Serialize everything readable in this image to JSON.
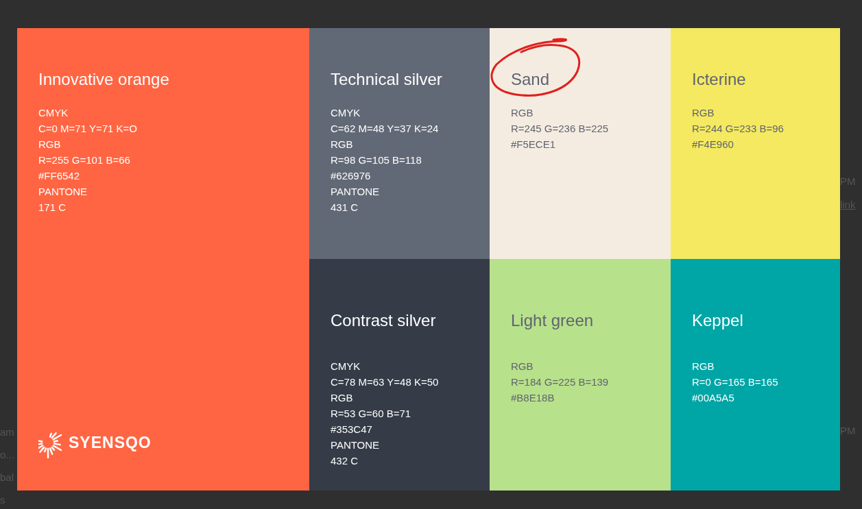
{
  "backdrop": {
    "left_fragments": [
      "am",
      "o...",
      "bal",
      "s"
    ],
    "right_fragments": [
      "PM",
      "link",
      "PM"
    ]
  },
  "slide": {
    "swatches": [
      {
        "name": "Innovative orange",
        "color": "#ff6542",
        "highlighted": false,
        "lines": [
          "CMYK",
          "C=0 M=71 Y=71 K=O",
          "RGB",
          "R=255 G=101 B=66",
          "#FF6542",
          "PANTONE",
          "171 C"
        ]
      },
      {
        "name": "Technical silver",
        "color": "#626976",
        "highlighted": false,
        "lines": [
          "CMYK",
          "C=62 M=48 Y=37 K=24",
          "RGB",
          "R=98 G=105 B=118",
          "#626976",
          "PANTONE",
          "431 C"
        ]
      },
      {
        "name": "Sand",
        "color": "#f5ece1",
        "highlighted": true,
        "lines": [
          "RGB",
          "R=245 G=236 B=225",
          "#F5ECE1"
        ]
      },
      {
        "name": "Icterine",
        "color": "#f4e960",
        "highlighted": false,
        "lines": [
          "RGB",
          "R=244 G=233 B=96",
          "#F4E960"
        ]
      },
      {
        "name": "Contrast silver",
        "color": "#353c47",
        "highlighted": false,
        "lines": [
          "CMYK",
          "C=78 M=63 Y=48 K=50",
          "RGB",
          "R=53 G=60 B=71",
          "#353C47",
          "PANTONE",
          "432 C"
        ]
      },
      {
        "name": "Light green",
        "color": "#b8e18b",
        "highlighted": false,
        "lines": [
          "RGB",
          "R=184 G=225 B=139",
          "#B8E18B"
        ]
      },
      {
        "name": "Keppel",
        "color": "#00a5a5",
        "highlighted": false,
        "lines": [
          "RGB",
          "R=0 G=165 B=165",
          "#00A5A5"
        ]
      }
    ],
    "logo": {
      "text": "SYENSQO"
    }
  }
}
